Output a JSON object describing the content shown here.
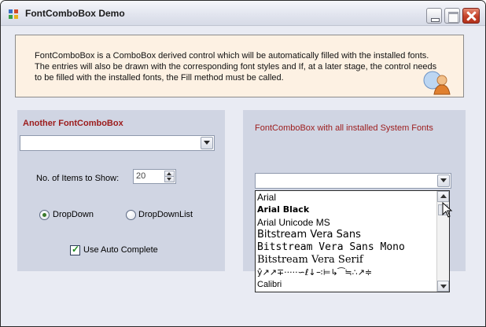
{
  "window": {
    "title": "FontComboBox Demo"
  },
  "info": {
    "text": "FontComboBox is a ComboBox derived control which will be automatically filled with the installed fonts. The entries will also be drawn with the corresponding font styles and If, at a later stage, the control needs to be filled with the installed fonts, the Fill method must be called."
  },
  "left_panel": {
    "heading": "Another FontComboBox",
    "combo_value": "",
    "items_label": "No. of Items to Show:",
    "items_value": "20",
    "radio_dropdown": "DropDown",
    "radio_dropdownlist": "DropDownList",
    "selected_style": "DropDown",
    "auto_complete_label": "Use Auto Complete",
    "auto_complete_checked": true
  },
  "right_panel": {
    "heading": "FontComboBox with all installed System Fonts",
    "combo_value": "",
    "dropdown_items": [
      "Arial",
      "Arial Black",
      "Arial Unicode MS",
      "Bitstream Vera Sans",
      "Bitstream Vera Sans Mono",
      "Bitstream Vera Serif",
      "ŷ↗↗∓·····∽ℓ↓∹⊨↳⁀≒∴↗≑",
      "Calibri"
    ]
  },
  "colors": {
    "heading_red": "#9c1b1b",
    "info_bg": "#fdf1e3",
    "panel_bg": "#d0d5e3"
  }
}
